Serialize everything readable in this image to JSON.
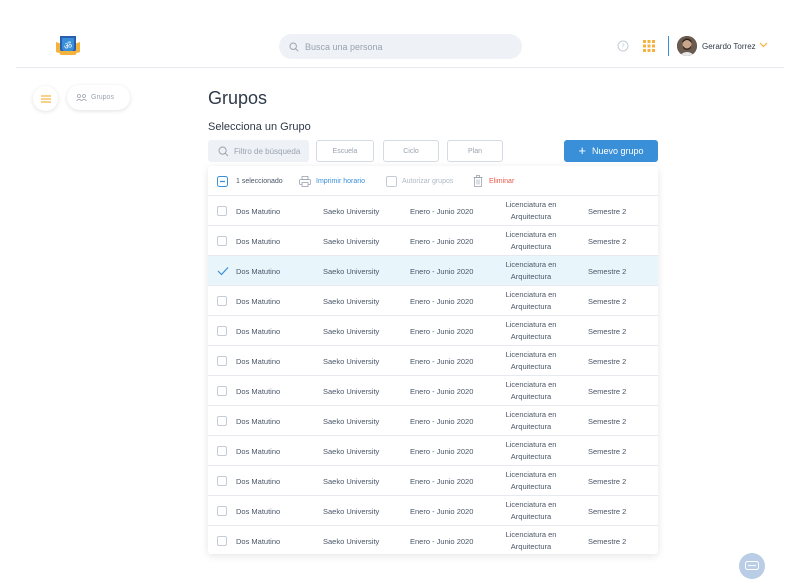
{
  "header": {
    "search_placeholder": "Busca una persona",
    "user_name": "Gerardo Torrez",
    "icons": [
      "logo-crest",
      "search-icon",
      "help-icon",
      "apps-grid-icon",
      "avatar",
      "chevron-down-icon"
    ],
    "accent_color": "#3a8fd9",
    "apps_color": "#f4b23e"
  },
  "nav": {
    "menu_icon": "hamburger-icon",
    "active_label": "Grupos"
  },
  "main": {
    "title": "Grupos",
    "subtitle": "Selecciona un Grupo",
    "filter_placeholder": "Filtro de búsqueda",
    "filters": [
      "Escuela",
      "Ciclo",
      "Plan"
    ],
    "new_button": "Nuevo grupo"
  },
  "toolbar": {
    "selected_count": "1 seleccionado",
    "print": "Imprimir horario",
    "authorize": "Autorizar grupos",
    "delete": "Eliminar"
  },
  "rows": [
    {
      "group": "Dos Matutino",
      "school": "Saeko University",
      "cycle": "Enero - Junio 2020",
      "plan": "Licenciatura en Arquitectura",
      "semester": "Semestre 2",
      "selected": false
    },
    {
      "group": "Dos Matutino",
      "school": "Saeko University",
      "cycle": "Enero - Junio 2020",
      "plan": "Licenciatura en Arquitectura",
      "semester": "Semestre 2",
      "selected": false
    },
    {
      "group": "Dos Matutino",
      "school": "Saeko University",
      "cycle": "Enero - Junio 2020",
      "plan": "Licenciatura en Arquitectura",
      "semester": "Semestre 2",
      "selected": true
    },
    {
      "group": "Dos Matutino",
      "school": "Saeko University",
      "cycle": "Enero - Junio 2020",
      "plan": "Licenciatura en Arquitectura",
      "semester": "Semestre 2",
      "selected": false
    },
    {
      "group": "Dos Matutino",
      "school": "Saeko University",
      "cycle": "Enero - Junio 2020",
      "plan": "Licenciatura en Arquitectura",
      "semester": "Semestre 2",
      "selected": false
    },
    {
      "group": "Dos Matutino",
      "school": "Saeko University",
      "cycle": "Enero - Junio 2020",
      "plan": "Licenciatura en Arquitectura",
      "semester": "Semestre 2",
      "selected": false
    },
    {
      "group": "Dos Matutino",
      "school": "Saeko University",
      "cycle": "Enero - Junio 2020",
      "plan": "Licenciatura en Arquitectura",
      "semester": "Semestre 2",
      "selected": false
    },
    {
      "group": "Dos Matutino",
      "school": "Saeko University",
      "cycle": "Enero - Junio 2020",
      "plan": "Licenciatura en Arquitectura",
      "semester": "Semestre 2",
      "selected": false
    },
    {
      "group": "Dos Matutino",
      "school": "Saeko University",
      "cycle": "Enero - Junio 2020",
      "plan": "Licenciatura en Arquitectura",
      "semester": "Semestre 2",
      "selected": false
    },
    {
      "group": "Dos Matutino",
      "school": "Saeko University",
      "cycle": "Enero - Junio 2020",
      "plan": "Licenciatura en Arquitectura",
      "semester": "Semestre 2",
      "selected": false
    },
    {
      "group": "Dos Matutino",
      "school": "Saeko University",
      "cycle": "Enero - Junio 2020",
      "plan": "Licenciatura en Arquitectura",
      "semester": "Semestre 2",
      "selected": false
    },
    {
      "group": "Dos Matutino",
      "school": "Saeko University",
      "cycle": "Enero - Junio 2020",
      "plan": "Licenciatura en Arquitectura",
      "semester": "Semestre 2",
      "selected": false
    }
  ],
  "chat_icon": "chat-icon"
}
